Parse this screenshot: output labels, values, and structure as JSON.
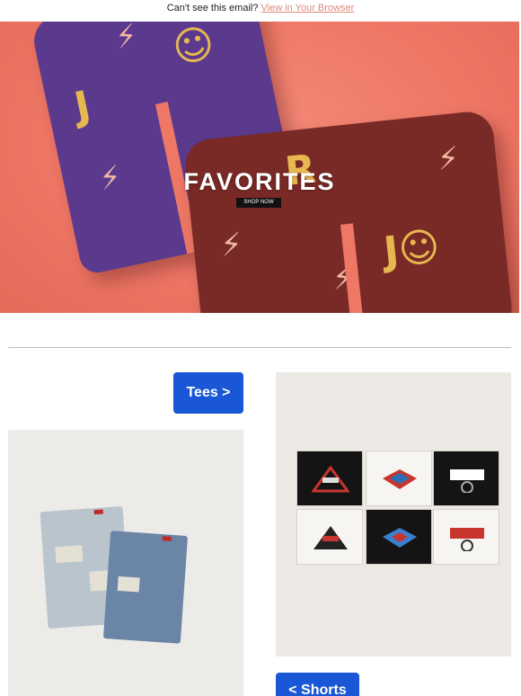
{
  "preheader": {
    "text": "Can't see this email?",
    "link_label": "View in Your Browser"
  },
  "hero": {
    "title": "FAVORITES",
    "button_label": "SHOP NOW"
  },
  "categories": {
    "tees_label": "Tees >",
    "shorts_label": "< Shorts"
  },
  "colors": {
    "accent": "#1a57d6",
    "hero_bg": "#ee7766",
    "link": "#e08a7a"
  },
  "icons": [
    "jr-smiley-print",
    "lightning-bolt-print"
  ]
}
